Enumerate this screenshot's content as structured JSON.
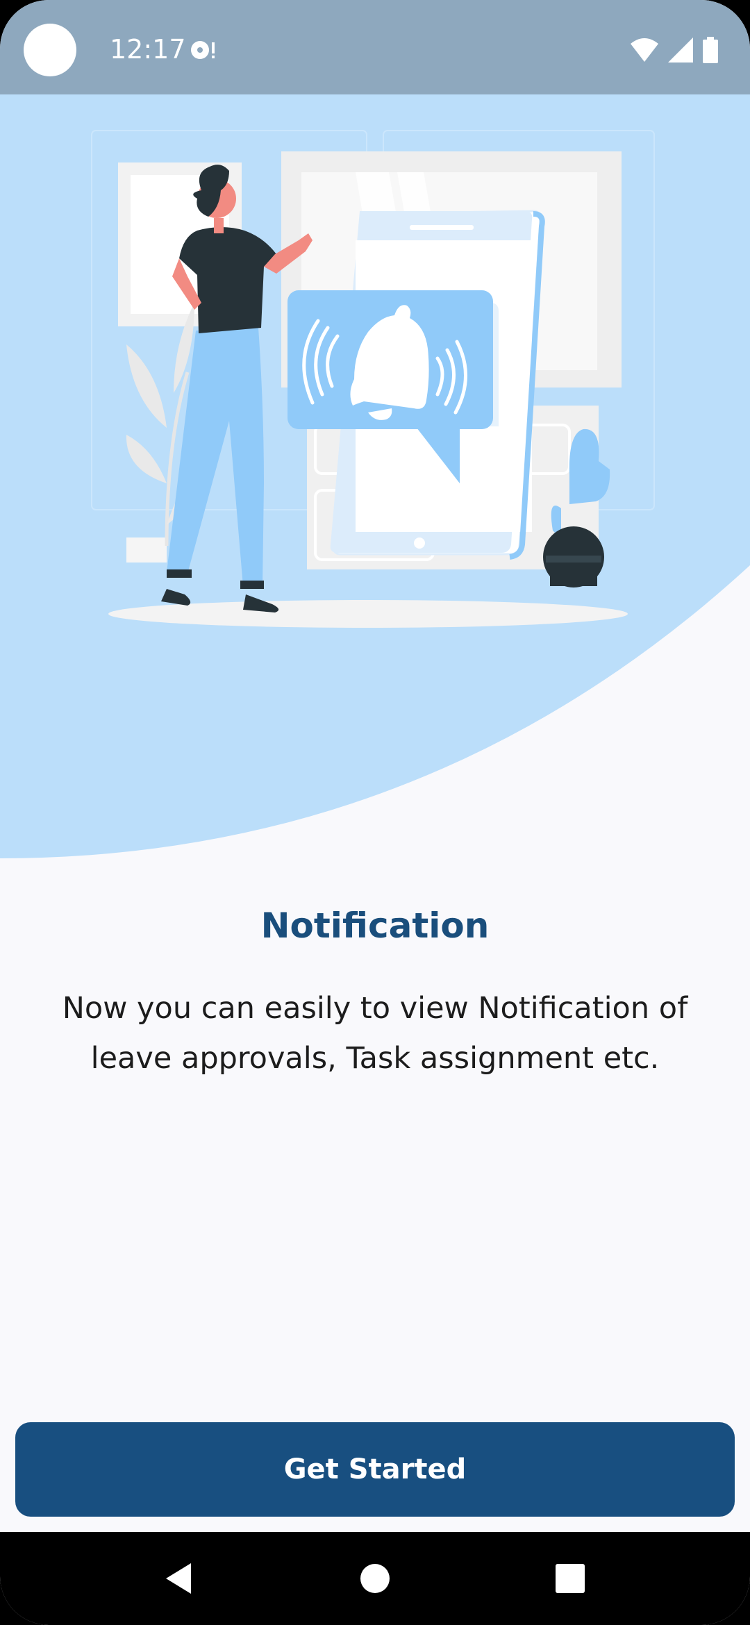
{
  "status_bar": {
    "time": "12:17",
    "icons": [
      "sync-icon",
      "wifi-icon",
      "cell-signal-icon",
      "battery-icon"
    ]
  },
  "onboarding": {
    "title": "Notification",
    "description": "Now you can easily to view Notification of leave approvals, Task assignment etc.",
    "button_label": "Get Started"
  },
  "nav_bar": {
    "buttons": [
      "back-icon",
      "home-icon",
      "recents-icon"
    ]
  },
  "colors": {
    "status_bar": "#8ea8be",
    "hero_background": "#bbdefa",
    "page_background": "#f9f9fc",
    "title": "#1a4e7c",
    "button": "#184f80",
    "illustration_accent": "#90caf9"
  }
}
